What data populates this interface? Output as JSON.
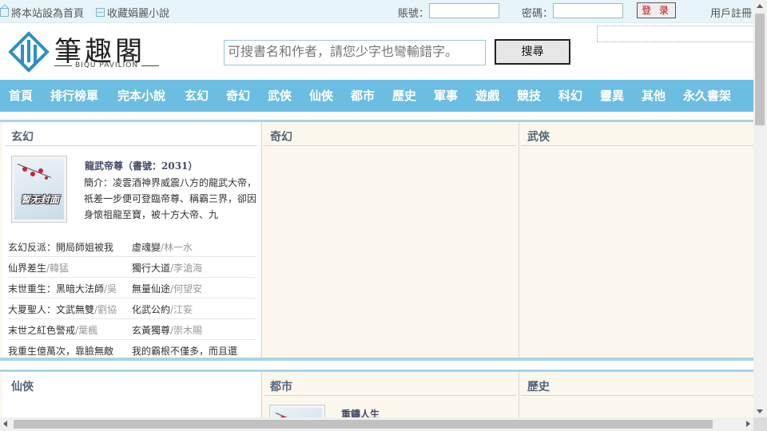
{
  "topbar": {
    "set_home": "將本站設為首頁",
    "bookmark": "收藏娟麗小說",
    "account_label": "賬號：",
    "password_label": "密碼：",
    "login_button": "登 录",
    "register": "用戶註冊"
  },
  "header": {
    "logo_title": "筆趣閣",
    "logo_subtitle": "BIQU PAVILION",
    "search_placeholder": "可搜書名和作者，請您少字也彎輸錯字。",
    "search_button": "搜尋"
  },
  "nav": {
    "items": [
      "首頁",
      "排行榜單",
      "完本小說",
      "玄幻",
      "奇幻",
      "武俠",
      "仙俠",
      "都市",
      "歷史",
      "軍事",
      "遊戲",
      "競技",
      "科幻",
      "靈異",
      "其他",
      "永久書架"
    ]
  },
  "section1": {
    "panels": [
      "玄幻",
      "奇幻",
      "武俠"
    ],
    "featured": {
      "title": "龍武帝尊（書號：2031）",
      "intro": "簡介：凌雲酒神界威震八方的龍武大帝，祇差一步便可登臨帝尊、稱霸三界，卻因身懷祖龍至寶，被十方大帝、九",
      "cover_text": "暂无封面"
    },
    "list": [
      {
        "book1": "玄幻反派：開局師姐被我",
        "author1": "",
        "book2": "虛魂變",
        "author2": "/林一水"
      },
      {
        "book1": "仙界差生",
        "author1": "/韓猛",
        "book2": "獨行大道",
        "author2": "/李滄海"
      },
      {
        "book1": "末世重生：黑暗大法師",
        "author1": "/吳",
        "book2": "無量仙途",
        "author2": "/何望安"
      },
      {
        "book1": "大夏聖人：文武無雙",
        "author1": "/劉協",
        "book2": "化武公約",
        "author2": "/江妄"
      },
      {
        "book1": "末世之紅色警戒",
        "author1": "/葉楓",
        "book2": "玄黃獨尊",
        "author2": "/崇木賜"
      },
      {
        "book1": "我重生億萬次，靠臉無敵",
        "author1": "",
        "book2": "我的霸根不僅多，而且還",
        "author2": ""
      }
    ]
  },
  "section2": {
    "panels": [
      "仙俠",
      "都市",
      "歷史"
    ],
    "featured": {
      "title": "重鑄人生"
    }
  }
}
